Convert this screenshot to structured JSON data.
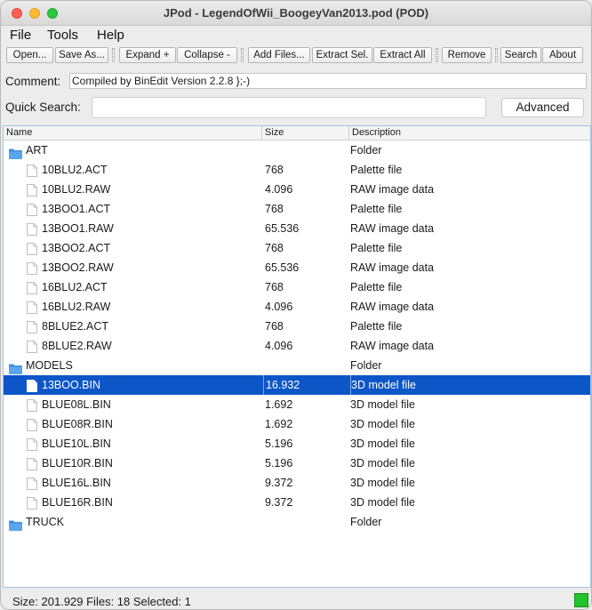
{
  "window": {
    "title": "JPod - LegendOfWii_BoogeyVan2013.pod (POD)"
  },
  "menu": [
    "File",
    "Tools",
    "Help"
  ],
  "toolbar": {
    "open": "Open...",
    "save_as": "Save As...",
    "expand": "Expand +",
    "collapse": "Collapse -",
    "add_files": "Add Files...",
    "extract_sel": "Extract Sel.",
    "extract_all": "Extract All",
    "remove": "Remove",
    "search": "Search",
    "about": "About"
  },
  "comment": {
    "label": "Comment:",
    "value": "Compiled by BinEdit Version 2.2.8 };-)"
  },
  "quick_search": {
    "label": "Quick Search:",
    "value": "",
    "advanced_label": "Advanced"
  },
  "table": {
    "columns": [
      "Name",
      "Size",
      "Description"
    ],
    "rows": [
      {
        "type": "folder",
        "name": "ART",
        "size": "",
        "description": "Folder"
      },
      {
        "type": "file",
        "name": "10BLU2.ACT",
        "size": "768",
        "description": "Palette file"
      },
      {
        "type": "file",
        "name": "10BLU2.RAW",
        "size": "4.096",
        "description": "RAW image data"
      },
      {
        "type": "file",
        "name": "13BOO1.ACT",
        "size": "768",
        "description": "Palette file"
      },
      {
        "type": "file",
        "name": "13BOO1.RAW",
        "size": "65.536",
        "description": "RAW image data"
      },
      {
        "type": "file",
        "name": "13BOO2.ACT",
        "size": "768",
        "description": "Palette file"
      },
      {
        "type": "file",
        "name": "13BOO2.RAW",
        "size": "65.536",
        "description": "RAW image data"
      },
      {
        "type": "file",
        "name": "16BLU2.ACT",
        "size": "768",
        "description": "Palette file"
      },
      {
        "type": "file",
        "name": "16BLU2.RAW",
        "size": "4.096",
        "description": "RAW image data"
      },
      {
        "type": "file",
        "name": "8BLUE2.ACT",
        "size": "768",
        "description": "Palette file"
      },
      {
        "type": "file",
        "name": "8BLUE2.RAW",
        "size": "4.096",
        "description": "RAW image data"
      },
      {
        "type": "folder",
        "name": "MODELS",
        "size": "",
        "description": "Folder"
      },
      {
        "type": "file",
        "name": "13BOO.BIN",
        "size": "16.932",
        "description": "3D model file",
        "selected": true
      },
      {
        "type": "file",
        "name": "BLUE08L.BIN",
        "size": "1.692",
        "description": "3D model file"
      },
      {
        "type": "file",
        "name": "BLUE08R.BIN",
        "size": "1.692",
        "description": "3D model file"
      },
      {
        "type": "file",
        "name": "BLUE10L.BIN",
        "size": "5.196",
        "description": "3D model file"
      },
      {
        "type": "file",
        "name": "BLUE10R.BIN",
        "size": "5.196",
        "description": "3D model file"
      },
      {
        "type": "file",
        "name": "BLUE16L.BIN",
        "size": "9.372",
        "description": "3D model file"
      },
      {
        "type": "file",
        "name": "BLUE16R.BIN",
        "size": "9.372",
        "description": "3D model file"
      },
      {
        "type": "folder",
        "name": "TRUCK",
        "size": "",
        "description": "Folder"
      }
    ]
  },
  "status": {
    "text": "Size:  201.929  Files:  18  Selected:  1",
    "indicator_color": "#22c32b"
  },
  "colors": {
    "selection": "#0d56c8",
    "folder": "#3f8ee0"
  }
}
